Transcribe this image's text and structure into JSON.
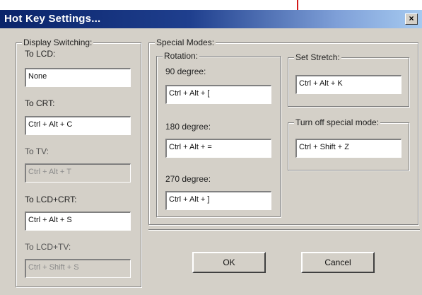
{
  "window": {
    "title": "Hot Key Settings...",
    "close_glyph": "×"
  },
  "display_switching": {
    "legend": "Display Switching:",
    "items": [
      {
        "label": "To LCD:",
        "value": "None",
        "enabled": true
      },
      {
        "label": "To CRT:",
        "value": "Ctrl + Alt + C",
        "enabled": true
      },
      {
        "label": "To TV:",
        "value": "Ctrl + Alt + T",
        "enabled": false
      },
      {
        "label": "To LCD+CRT:",
        "value": "Ctrl + Alt + S",
        "enabled": true
      },
      {
        "label": "To LCD+TV:",
        "value": "Ctrl + Shift + S",
        "enabled": false
      }
    ]
  },
  "special_modes": {
    "legend": "Special Modes:",
    "rotation": {
      "legend": "Rotation:",
      "items": [
        {
          "label": "90 degree:",
          "value": "Ctrl + Alt + ["
        },
        {
          "label": "180 degree:",
          "value": "Ctrl + Alt + ="
        },
        {
          "label": "270 degree:",
          "value": "Ctrl + Alt + ]"
        }
      ]
    },
    "set_stretch": {
      "legend": "Set Stretch:",
      "value": "Ctrl + Alt + K"
    },
    "turn_off": {
      "legend": "Turn off special mode:",
      "value": "Ctrl + Shift + Z"
    }
  },
  "buttons": {
    "ok": "OK",
    "cancel": "Cancel"
  },
  "colors": {
    "titlebar_start": "#0a246a",
    "titlebar_end": "#a6caf0",
    "face": "#d4d0c8",
    "accent_mark": "#d31a1a"
  }
}
